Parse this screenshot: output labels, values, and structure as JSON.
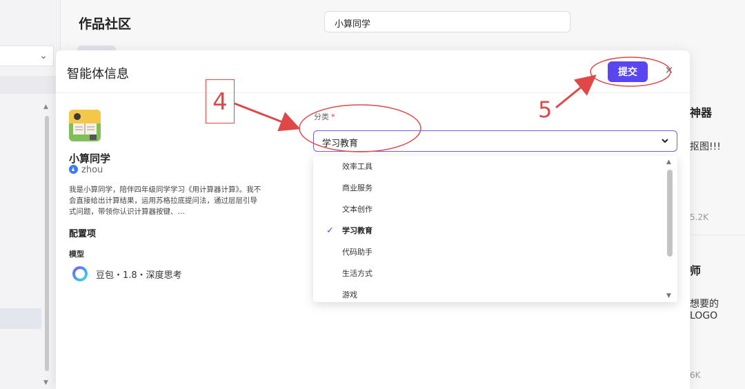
{
  "background": {
    "page_title": "作品社区",
    "search_value": "小算同学",
    "right_items": [
      {
        "title": "神器",
        "subtitle": "抠图!!!",
        "count": "5.2K"
      },
      {
        "title": "师",
        "subtitle": "想要的LOGO",
        "count": "6K"
      }
    ]
  },
  "modal": {
    "title": "智能体信息",
    "submit_label": "提交",
    "close_icon": "close-icon",
    "agent": {
      "name": "小算同学",
      "author": "zhou",
      "description": "我是小算同学，陪伴四年级同学学习《用计算器计算》。我不会直接给出计算结果，运用苏格拉底提问法，通过层层引导式问题，带领你认识计算器按键、…"
    },
    "config": {
      "section_label": "配置项",
      "model_label": "模型",
      "model_value": "豆包・1.8・深度思考"
    },
    "category": {
      "label": "分类",
      "required_mark": "*",
      "selected": "学习教育",
      "options": [
        {
          "label": "效率工具",
          "selected": false
        },
        {
          "label": "商业服务",
          "selected": false
        },
        {
          "label": "文本创作",
          "selected": false
        },
        {
          "label": "学习教育",
          "selected": true
        },
        {
          "label": "代码助手",
          "selected": false
        },
        {
          "label": "生活方式",
          "selected": false
        },
        {
          "label": "游戏",
          "selected": false
        }
      ]
    }
  },
  "annotations": {
    "step_4": "4",
    "step_5": "5",
    "color": "#e04848"
  },
  "colors": {
    "accent": "#5a45f0",
    "required": "#e53935"
  }
}
